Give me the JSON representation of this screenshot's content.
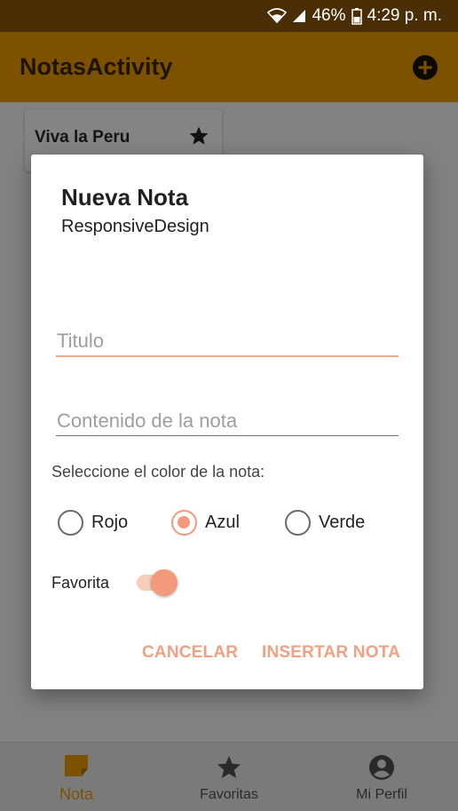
{
  "status_bar": {
    "battery": "46%",
    "time": "4:29 p. m.",
    "icons": [
      "wifi-icon",
      "signal-icon",
      "battery-icon"
    ]
  },
  "app_bar": {
    "title": "NotasActivity",
    "add_icon": "add-circle-icon"
  },
  "notes": [
    {
      "title": "Viva la Peru",
      "icon": "star-icon"
    }
  ],
  "dialog": {
    "title": "Nueva Nota",
    "subtitle": "ResponsiveDesign",
    "title_placeholder": "Titulo",
    "content_placeholder": "Contenido de la nota",
    "color_label": "Seleccione el color de la nota:",
    "colors": [
      {
        "label": "Rojo",
        "checked": false
      },
      {
        "label": "Azul",
        "checked": true
      },
      {
        "label": "Verde",
        "checked": false
      }
    ],
    "favorite_label": "Favorita",
    "favorite_on": true,
    "cancel_label": "CANCELAR",
    "insert_label": "INSERTAR NOTA"
  },
  "bottom_nav": [
    {
      "label": "Nota",
      "icon": "note-icon",
      "active": true
    },
    {
      "label": "Favoritas",
      "icon": "star-icon",
      "active": false
    },
    {
      "label": "Mi Perfil",
      "icon": "account-circle-icon",
      "active": false
    }
  ],
  "colors": {
    "status_bar": "#4a2e06",
    "app_bar_dimmed": "#7c5201",
    "accent": "#f39a7c",
    "dim_background": "#828282"
  }
}
